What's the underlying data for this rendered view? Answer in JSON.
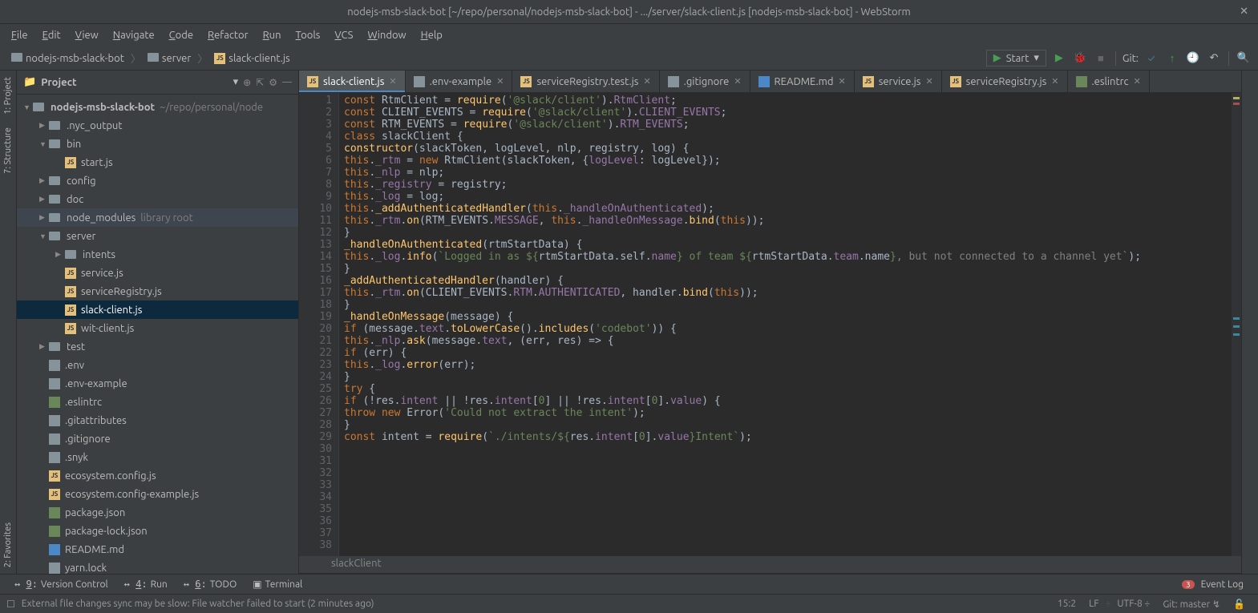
{
  "window": {
    "title": "nodejs-msb-slack-bot [~/repo/personal/nodejs-msb-slack-bot] - .../server/slack-client.js [nodejs-msb-slack-bot] - WebStorm"
  },
  "menu": {
    "items": [
      "File",
      "Edit",
      "View",
      "Navigate",
      "Code",
      "Refactor",
      "Run",
      "Tools",
      "VCS",
      "Window",
      "Help"
    ]
  },
  "breadcrumb": {
    "items": [
      "nodejs-msb-slack-bot",
      "server",
      "slack-client.js"
    ]
  },
  "toolbar": {
    "run_config": "Start",
    "git_label": "Git:"
  },
  "left_tabs": [
    "1: Project",
    "7: Structure",
    "2: Favorites"
  ],
  "project_panel": {
    "title": "Project",
    "root": "nodejs-msb-slack-bot",
    "root_path": "~/repo/personal/node",
    "tree": [
      {
        "name": ".nyc_output",
        "type": "folder",
        "depth": 1,
        "expandable": true
      },
      {
        "name": "bin",
        "type": "folder",
        "depth": 1,
        "expandable": true,
        "expanded": true
      },
      {
        "name": "start.js",
        "type": "js",
        "depth": 2
      },
      {
        "name": "config",
        "type": "folder",
        "depth": 1,
        "expandable": true
      },
      {
        "name": "doc",
        "type": "folder",
        "depth": 1,
        "expandable": true
      },
      {
        "name": "node_modules",
        "type": "folder",
        "depth": 1,
        "expandable": true,
        "note": "library root"
      },
      {
        "name": "server",
        "type": "folder",
        "depth": 1,
        "expandable": true,
        "expanded": true
      },
      {
        "name": "intents",
        "type": "folder",
        "depth": 2,
        "expandable": true
      },
      {
        "name": "service.js",
        "type": "js",
        "depth": 2
      },
      {
        "name": "serviceRegistry.js",
        "type": "js",
        "depth": 2
      },
      {
        "name": "slack-client.js",
        "type": "js",
        "depth": 2,
        "selected": true
      },
      {
        "name": "wit-client.js",
        "type": "js",
        "depth": 2
      },
      {
        "name": "test",
        "type": "folder",
        "depth": 1,
        "expandable": true
      },
      {
        "name": ".env",
        "type": "txt",
        "depth": 1
      },
      {
        "name": ".env-example",
        "type": "txt",
        "depth": 1
      },
      {
        "name": ".eslintrc",
        "type": "json",
        "depth": 1
      },
      {
        "name": ".gitattributes",
        "type": "txt",
        "depth": 1
      },
      {
        "name": ".gitignore",
        "type": "txt",
        "depth": 1
      },
      {
        "name": ".snyk",
        "type": "txt",
        "depth": 1
      },
      {
        "name": "ecosystem.config.js",
        "type": "js",
        "depth": 1
      },
      {
        "name": "ecosystem.config-example.js",
        "type": "js",
        "depth": 1
      },
      {
        "name": "package.json",
        "type": "json",
        "depth": 1
      },
      {
        "name": "package-lock.json",
        "type": "json",
        "depth": 1
      },
      {
        "name": "README.md",
        "type": "md",
        "depth": 1
      },
      {
        "name": "yarn.lock",
        "type": "txt",
        "depth": 1
      }
    ]
  },
  "tabs": [
    {
      "label": "slack-client.js",
      "type": "js",
      "active": true
    },
    {
      "label": ".env-example",
      "type": "txt"
    },
    {
      "label": "serviceRegistry.test.js",
      "type": "js"
    },
    {
      "label": ".gitignore",
      "type": "txt"
    },
    {
      "label": "README.md",
      "type": "md"
    },
    {
      "label": "service.js",
      "type": "js"
    },
    {
      "label": "serviceRegistry.js",
      "type": "js"
    },
    {
      "label": ".eslintrc",
      "type": "json"
    }
  ],
  "code": {
    "lines": [
      {
        "n": 1,
        "tokens": [
          [
            "kw",
            "const"
          ],
          [
            "",
            " RtmClient = "
          ],
          [
            "fn",
            "require"
          ],
          [
            "",
            "("
          ],
          [
            "str",
            "'@slack/client'"
          ],
          [
            "",
            ")."
          ],
          [
            "prop",
            "RtmClient"
          ],
          [
            "",
            ";"
          ]
        ]
      },
      {
        "n": 2,
        "tokens": [
          [
            "kw",
            "const"
          ],
          [
            "",
            " CLIENT_EVENTS = "
          ],
          [
            "fn",
            "require"
          ],
          [
            "",
            "("
          ],
          [
            "str",
            "'@slack/client'"
          ],
          [
            "",
            ")."
          ],
          [
            "prop",
            "CLIENT_EVENTS"
          ],
          [
            "",
            ";"
          ]
        ]
      },
      {
        "n": 3,
        "tokens": [
          [
            "kw",
            "const"
          ],
          [
            "",
            " RTM_EVENTS = "
          ],
          [
            "fn",
            "require"
          ],
          [
            "",
            "("
          ],
          [
            "str",
            "'@slack/client'"
          ],
          [
            "",
            ")."
          ],
          [
            "prop",
            "RTM_EVENTS"
          ],
          [
            "",
            ";"
          ]
        ]
      },
      {
        "n": 4,
        "tokens": [
          [
            "",
            ""
          ]
        ]
      },
      {
        "n": 5,
        "tokens": [
          [
            "kw",
            "class"
          ],
          [
            "",
            " slackClient {"
          ]
        ]
      },
      {
        "n": 6,
        "tokens": [
          [
            "fn",
            "constructor"
          ],
          [
            "",
            "(slackToken, logLevel, nlp, registry, log) {"
          ]
        ]
      },
      {
        "n": 7,
        "tokens": [
          [
            "this",
            "this"
          ],
          [
            "",
            "."
          ],
          [
            "prop",
            "_rtm"
          ],
          [
            "",
            " = "
          ],
          [
            "kw",
            "new"
          ],
          [
            "",
            " RtmClient(slackToken, {"
          ],
          [
            "prop",
            "logLevel"
          ],
          [
            "",
            ": logLevel});"
          ]
        ]
      },
      {
        "n": 8,
        "tokens": [
          [
            "this",
            "this"
          ],
          [
            "",
            "."
          ],
          [
            "prop",
            "_nlp"
          ],
          [
            "",
            " = nlp;"
          ]
        ]
      },
      {
        "n": 9,
        "tokens": [
          [
            "this",
            "this"
          ],
          [
            "",
            "."
          ],
          [
            "prop",
            "_registry"
          ],
          [
            "",
            " = registry;"
          ]
        ]
      },
      {
        "n": 10,
        "tokens": [
          [
            "this",
            "this"
          ],
          [
            "",
            "."
          ],
          [
            "prop",
            "_log"
          ],
          [
            "",
            " = log;"
          ]
        ]
      },
      {
        "n": 11,
        "tokens": [
          [
            "",
            ""
          ]
        ]
      },
      {
        "n": 12,
        "tokens": [
          [
            "this",
            "this"
          ],
          [
            "",
            "."
          ],
          [
            "fn",
            "_addAuthenticatedHandler"
          ],
          [
            "",
            "("
          ],
          [
            "this",
            "this"
          ],
          [
            "",
            "."
          ],
          [
            "prop",
            "_handleOnAuthenticated"
          ],
          [
            "",
            ");"
          ]
        ]
      },
      {
        "n": 13,
        "tokens": [
          [
            "",
            ""
          ]
        ]
      },
      {
        "n": 14,
        "tokens": [
          [
            "this",
            "this"
          ],
          [
            "",
            "."
          ],
          [
            "prop",
            "_rtm"
          ],
          [
            "",
            "."
          ],
          [
            "fn",
            "on"
          ],
          [
            "",
            "(RTM_EVENTS."
          ],
          [
            "prop",
            "MESSAGE"
          ],
          [
            "",
            ", "
          ],
          [
            "this",
            "this"
          ],
          [
            "",
            "."
          ],
          [
            "prop",
            "_handleOnMessage"
          ],
          [
            "",
            "."
          ],
          [
            "fn",
            "bind"
          ],
          [
            "",
            "("
          ],
          [
            "this",
            "this"
          ],
          [
            "",
            "));"
          ]
        ]
      },
      {
        "n": 15,
        "tokens": [
          [
            "",
            "}"
          ]
        ]
      },
      {
        "n": 16,
        "tokens": [
          [
            "",
            ""
          ]
        ]
      },
      {
        "n": 17,
        "tokens": [
          [
            "fn",
            "_handleOnAuthenticated"
          ],
          [
            "",
            "(rtmStartData) {"
          ]
        ]
      },
      {
        "n": 18,
        "tokens": [
          [
            "this",
            "this"
          ],
          [
            "",
            "."
          ],
          [
            "prop",
            "_log"
          ],
          [
            "",
            "."
          ],
          [
            "fn",
            "info"
          ],
          [
            "",
            "("
          ],
          [
            "str",
            "`Logged in as ${"
          ],
          [
            "",
            "rtmStartData.self."
          ],
          [
            "prop",
            "name"
          ],
          [
            "str",
            "} of team ${"
          ],
          [
            "",
            "rtmStartData."
          ],
          [
            "prop",
            "team"
          ],
          [
            "",
            ".name"
          ],
          [
            "str",
            "}"
          ],
          [
            "cmt",
            ", but not connected to a channel yet`"
          ],
          [
            "",
            ");"
          ]
        ]
      },
      {
        "n": 19,
        "tokens": [
          [
            "",
            "}"
          ]
        ]
      },
      {
        "n": 20,
        "tokens": [
          [
            "",
            ""
          ]
        ]
      },
      {
        "n": 21,
        "tokens": [
          [
            "fn",
            "_addAuthenticatedHandler"
          ],
          [
            "",
            "(handler) {"
          ]
        ]
      },
      {
        "n": 22,
        "tokens": [
          [
            "this",
            "this"
          ],
          [
            "",
            "."
          ],
          [
            "prop",
            "_rtm"
          ],
          [
            "",
            "."
          ],
          [
            "fn",
            "on"
          ],
          [
            "",
            "(CLIENT_EVENTS."
          ],
          [
            "prop",
            "RTM"
          ],
          [
            "",
            "."
          ],
          [
            "prop",
            "AUTHENTICATED"
          ],
          [
            "",
            ", handler."
          ],
          [
            "fn",
            "bind"
          ],
          [
            "",
            "("
          ],
          [
            "this",
            "this"
          ],
          [
            "",
            "));"
          ]
        ]
      },
      {
        "n": 23,
        "tokens": [
          [
            "",
            "}"
          ]
        ]
      },
      {
        "n": 24,
        "tokens": [
          [
            "",
            ""
          ]
        ]
      },
      {
        "n": 25,
        "tokens": [
          [
            "fn",
            "_handleOnMessage"
          ],
          [
            "",
            "(message) {"
          ]
        ]
      },
      {
        "n": 26,
        "tokens": [
          [
            "kw",
            "if"
          ],
          [
            "",
            " (message."
          ],
          [
            "prop",
            "text"
          ],
          [
            "",
            "."
          ],
          [
            "fn",
            "toLowerCase"
          ],
          [
            "",
            "()."
          ],
          [
            "fn",
            "includes"
          ],
          [
            "",
            "("
          ],
          [
            "str",
            "'codebot'"
          ],
          [
            "",
            ")) {"
          ]
        ]
      },
      {
        "n": 27,
        "tokens": [
          [
            "this",
            "this"
          ],
          [
            "",
            "."
          ],
          [
            "prop",
            "_nlp"
          ],
          [
            "",
            "."
          ],
          [
            "fn",
            "ask"
          ],
          [
            "",
            "(message."
          ],
          [
            "prop",
            "text"
          ],
          [
            "",
            ", (err, res) => {"
          ]
        ]
      },
      {
        "n": 28,
        "tokens": [
          [
            "kw",
            "if"
          ],
          [
            "",
            " (err) {"
          ]
        ]
      },
      {
        "n": 29,
        "tokens": [
          [
            "this",
            "this"
          ],
          [
            "",
            "."
          ],
          [
            "prop",
            "_log"
          ],
          [
            "",
            "."
          ],
          [
            "fn",
            "error"
          ],
          [
            "",
            "(err);"
          ]
        ]
      },
      {
        "n": 30,
        "tokens": [
          [
            "",
            "}"
          ]
        ]
      },
      {
        "n": 31,
        "tokens": [
          [
            "",
            ""
          ]
        ]
      },
      {
        "n": 32,
        "tokens": [
          [
            "kw",
            "try"
          ],
          [
            "",
            " {"
          ]
        ]
      },
      {
        "n": 33,
        "tokens": [
          [
            "kw",
            "if"
          ],
          [
            "",
            " (!res."
          ],
          [
            "prop",
            "intent"
          ],
          [
            "",
            " || !res."
          ],
          [
            "prop",
            "intent"
          ],
          [
            "",
            "["
          ],
          [
            "str",
            "0"
          ],
          [
            "",
            ""
          ],
          [
            "",
            "] || !res."
          ],
          [
            "prop",
            "intent"
          ],
          [
            "",
            "["
          ],
          [
            "str",
            "0"
          ],
          [
            "",
            "]."
          ],
          [
            "prop",
            "value"
          ],
          [
            "",
            ") {"
          ]
        ]
      },
      {
        "n": 34,
        "tokens": [
          [
            "kw",
            "throw"
          ],
          [
            "",
            " "
          ],
          [
            "kw",
            "new"
          ],
          [
            "",
            " Error("
          ],
          [
            "str",
            "'Could not extract the intent'"
          ],
          [
            "",
            ");"
          ]
        ]
      },
      {
        "n": 35,
        "tokens": [
          [
            "",
            "}"
          ]
        ]
      },
      {
        "n": 36,
        "tokens": [
          [
            "",
            ""
          ]
        ]
      },
      {
        "n": 37,
        "tokens": [
          [
            "kw",
            "const"
          ],
          [
            "",
            " intent = "
          ],
          [
            "fn",
            "require"
          ],
          [
            "",
            "("
          ],
          [
            "str",
            "`./intents/${"
          ],
          [
            "",
            "res."
          ],
          [
            "prop",
            "intent"
          ],
          [
            "",
            "["
          ],
          [
            "str",
            "0"
          ],
          [
            "",
            "]."
          ],
          [
            "prop",
            "value"
          ],
          [
            "str",
            "}Intent`"
          ],
          [
            "",
            ");"
          ]
        ]
      },
      {
        "n": 38,
        "tokens": [
          [
            "",
            ""
          ]
        ]
      }
    ],
    "context": "slackClient"
  },
  "bottom_tools": {
    "items": [
      {
        "key": "9",
        "label": "Version Control"
      },
      {
        "key": "4",
        "label": "Run"
      },
      {
        "key": "6",
        "label": "TODO"
      },
      {
        "key": "",
        "label": "Terminal"
      }
    ],
    "event_log": "Event Log",
    "event_count": "3"
  },
  "status": {
    "message": "External file changes sync may be slow: File watcher failed to start (2 minutes ago)",
    "position": "15:2",
    "line_sep": "LF",
    "encoding": "UTF-8",
    "git_branch": "Git: master"
  }
}
